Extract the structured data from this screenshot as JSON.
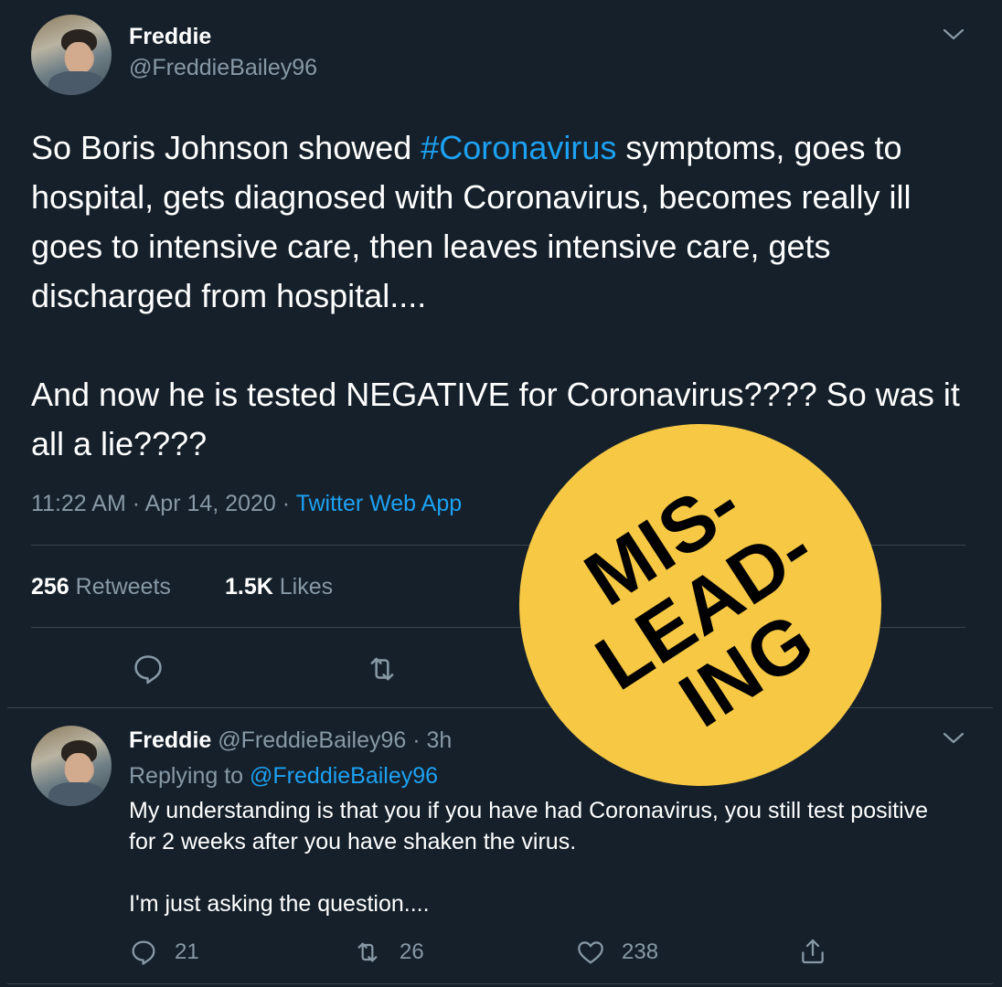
{
  "tweet": {
    "display_name": "Freddie",
    "handle": "@FreddieBailey96",
    "text_part1": "So Boris Johnson showed ",
    "hashtag": "#Coronavirus",
    "text_part2": " symptoms, goes to hospital, gets diagnosed with Coronavirus, becomes really ill goes to intensive care, then leaves intensive care, gets discharged from hospital....",
    "text_para2": "And now he is tested NEGATIVE for Coronavirus???? So was it all a lie????",
    "time": "11:22 AM",
    "sep1": " · ",
    "date": "Apr 14, 2020",
    "sep2": " · ",
    "source": "Twitter Web App",
    "retweets_count": "256",
    "retweets_label": "Retweets",
    "likes_count": "1.5K",
    "likes_label": "Likes"
  },
  "reply": {
    "display_name": "Freddie",
    "handle": "@FreddieBailey96",
    "sep": " · ",
    "age": "3h",
    "replying_prefix": "Replying to ",
    "replying_handle": "@FreddieBailey96",
    "text_line1": "My understanding is that you if you have had Coronavirus, you still test positive for 2 weeks after you have shaken the virus.",
    "text_line2": "I'm just asking the question....",
    "reply_count": "21",
    "retweet_count": "26",
    "like_count": "238"
  },
  "stamp": {
    "line1": "MIS-",
    "line2": "LEAD-",
    "line3": "ING"
  },
  "colors": {
    "background": "#15202b",
    "link": "#1da1f2",
    "muted": "#8899a6",
    "stamp": "#f7c844"
  }
}
